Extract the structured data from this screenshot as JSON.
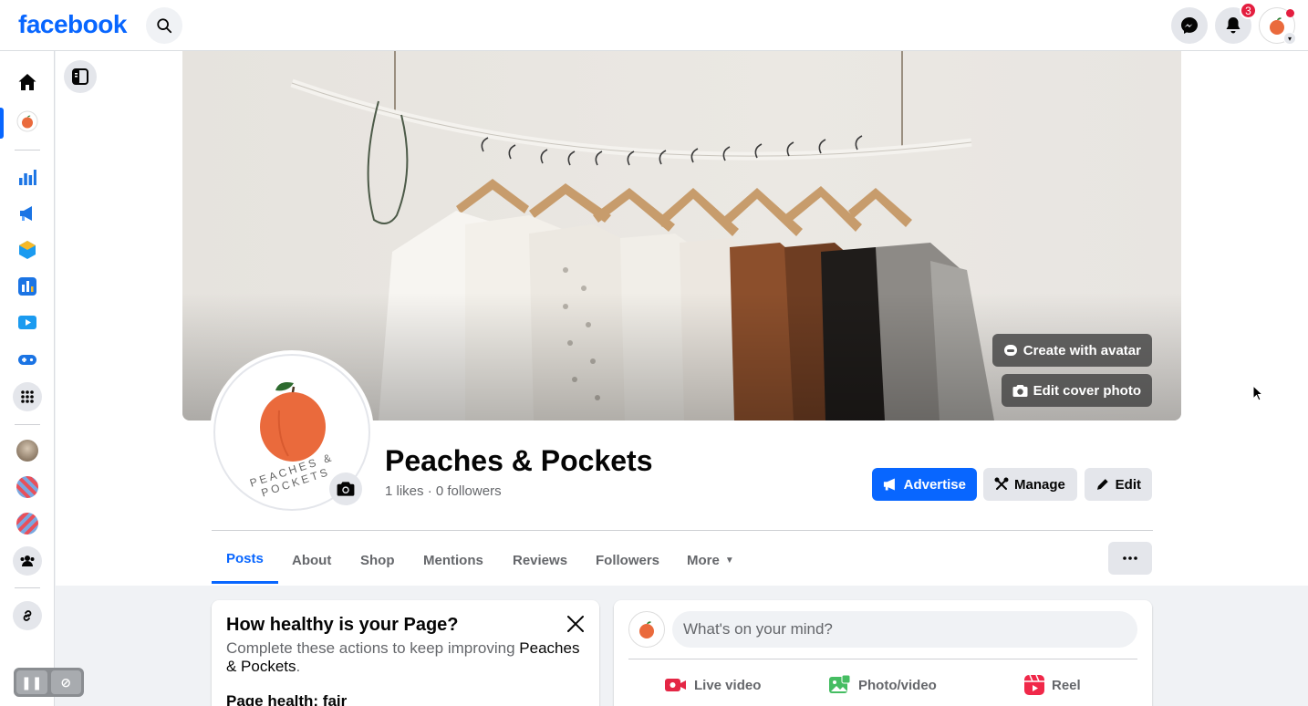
{
  "topnav": {
    "logo": "facebook",
    "notifications_count": "3",
    "icons": [
      "search-icon",
      "messenger-icon",
      "bell-icon",
      "profile-avatar"
    ]
  },
  "rail": {
    "items": [
      "home-icon",
      "page-avatar",
      "insights-icon",
      "ads-icon",
      "meta-business-icon",
      "dashboard-icon",
      "video-icon",
      "gaming-icon",
      "apps-grid-icon",
      "friend-avatar-1",
      "page-avatar-2",
      "page-avatar-3",
      "groups-icon",
      "link-icon"
    ]
  },
  "cover": {
    "create_avatar_label": "Create with avatar",
    "edit_cover_label": "Edit cover photo"
  },
  "profile": {
    "name": "Peaches & Pockets",
    "logo_text": "PEACHES & POCKETS",
    "likes": "1 likes",
    "separator": "·",
    "followers": "0 followers"
  },
  "actions": {
    "advertise": "Advertise",
    "manage": "Manage",
    "edit": "Edit"
  },
  "tabs": [
    {
      "label": "Posts",
      "active": true
    },
    {
      "label": "About"
    },
    {
      "label": "Shop"
    },
    {
      "label": "Mentions"
    },
    {
      "label": "Reviews"
    },
    {
      "label": "Followers"
    },
    {
      "label": "More"
    }
  ],
  "health_card": {
    "title": "How healthy is your Page?",
    "desc_prefix": "Complete these actions to keep improving ",
    "desc_page": "Peaches & Pockets",
    "desc_suffix": ".",
    "status": "Page health: fair"
  },
  "composer": {
    "placeholder": "What's on your mind?",
    "live_video": "Live video",
    "photo_video": "Photo/video",
    "reel": "Reel"
  },
  "colors": {
    "brand_blue": "#0866ff",
    "peach": "#ea6a3c",
    "badge_red": "#e41e3f"
  }
}
